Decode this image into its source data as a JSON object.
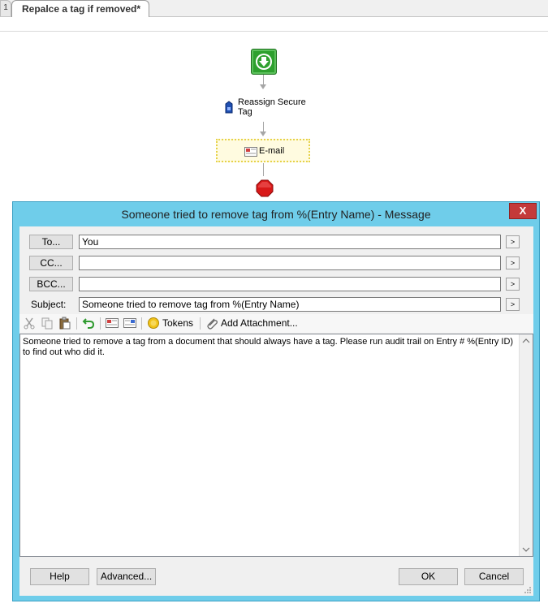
{
  "tabs": [
    {
      "label": "1",
      "active": false
    },
    {
      "label": "Repalce a tag if removed*",
      "active": true
    }
  ],
  "workflow": {
    "start_icon": "start-arrow-icon",
    "step1_label": "Reassign Secure Tag",
    "step2_label": "E-mail",
    "end_icon": "stop-icon"
  },
  "dialog": {
    "title": "Someone tried to remove tag from %(Entry Name) - Message",
    "close_label": "X",
    "to_label": "To...",
    "to_value": "You",
    "cc_label": "CC...",
    "cc_value": "",
    "bcc_label": "BCC...",
    "bcc_value": "",
    "subject_label": "Subject:",
    "subject_value": "Someone tried to remove tag from %(Entry Name)",
    "expand_label": ">",
    "toolbar": {
      "tokens_label": "Tokens",
      "attachment_label": "Add Attachment..."
    },
    "body": "Someone tried to remove a tag from a document that should always have a tag.  Please run audit trail on Entry # %(Entry ID) to find out who did it.",
    "help_label": "Help",
    "advanced_label": "Advanced...",
    "ok_label": "OK",
    "cancel_label": "Cancel"
  },
  "colors": {
    "dialog_frame": "#6fcdea",
    "close_button": "#c43a3a",
    "start_node": "#2ea02e",
    "selection": "#e6d24a"
  }
}
